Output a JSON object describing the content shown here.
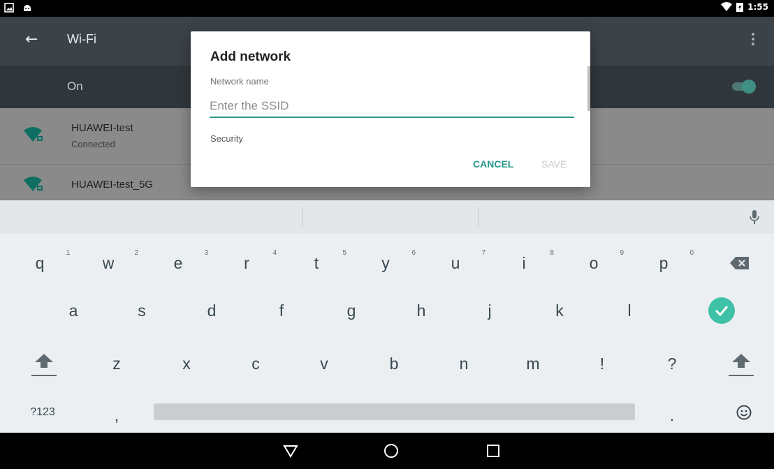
{
  "status_bar": {
    "time": "1:55"
  },
  "settings": {
    "title": "Wi-Fi",
    "switch_label": "On",
    "networks": [
      {
        "name": "HUAWEI-test",
        "status": "Connected"
      },
      {
        "name": "HUAWEI-test_5G",
        "status": ""
      }
    ]
  },
  "dialog": {
    "title": "Add network",
    "network_name_label": "Network name",
    "ssid_placeholder": "Enter the SSID",
    "security_label": "Security",
    "cancel_label": "CANCEL",
    "save_label": "SAVE"
  },
  "keyboard": {
    "row1": [
      {
        "key": "q",
        "hint": "1"
      },
      {
        "key": "w",
        "hint": "2"
      },
      {
        "key": "e",
        "hint": "3"
      },
      {
        "key": "r",
        "hint": "4"
      },
      {
        "key": "t",
        "hint": "5"
      },
      {
        "key": "y",
        "hint": "6"
      },
      {
        "key": "u",
        "hint": "7"
      },
      {
        "key": "i",
        "hint": "8"
      },
      {
        "key": "o",
        "hint": "9"
      },
      {
        "key": "p",
        "hint": "0"
      }
    ],
    "row2": [
      "a",
      "s",
      "d",
      "f",
      "g",
      "h",
      "j",
      "k",
      "l"
    ],
    "row3": [
      "z",
      "x",
      "c",
      "v",
      "b",
      "n",
      "m",
      "!",
      "?"
    ],
    "symbols_label": "?123",
    "comma": ",",
    "period": "."
  },
  "colors": {
    "accent": "#27998c",
    "app_bar": "#3b4248",
    "keyboard_bg": "#eceff1"
  },
  "icons": {
    "back": "arrow-left-icon",
    "more": "more-vert-icon",
    "wifi": "wifi-lock-icon",
    "mic": "mic-icon",
    "backspace": "backspace-icon",
    "done": "check-circle-icon",
    "shift": "shift-icon",
    "emoji": "emoji-icon",
    "nav_back": "triangle-back-icon",
    "nav_home": "circle-home-icon",
    "nav_recents": "square-recents-icon"
  }
}
